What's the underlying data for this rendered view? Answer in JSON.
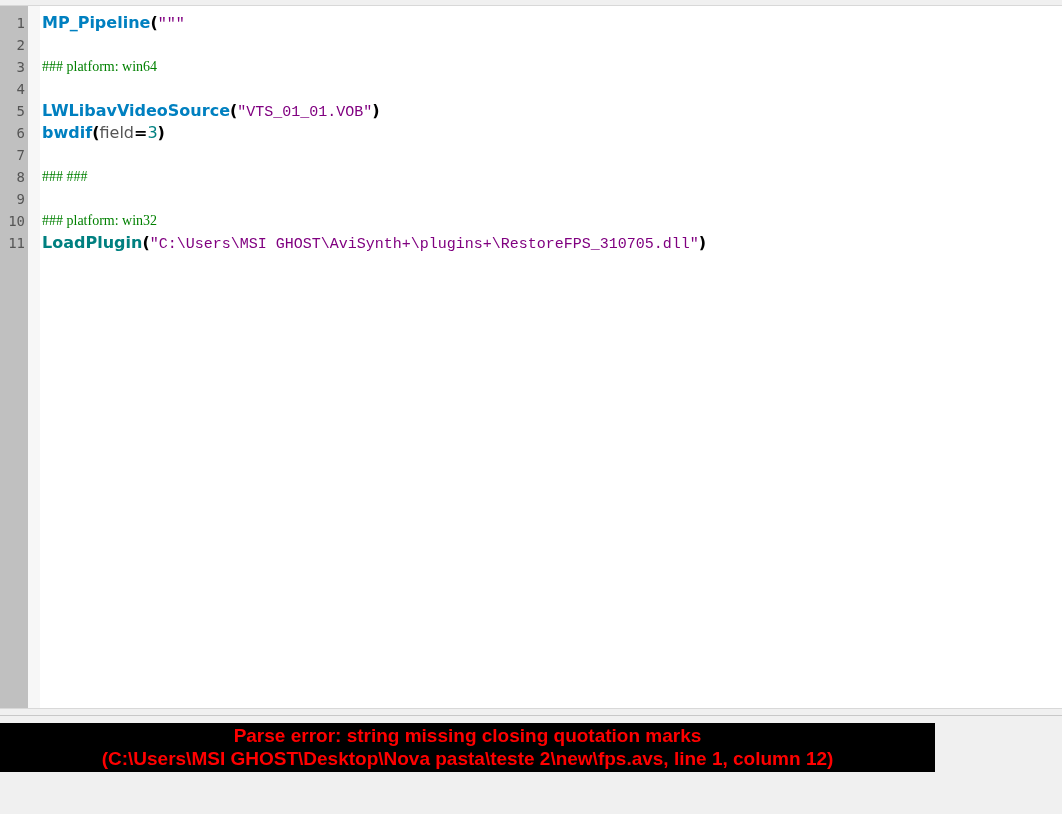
{
  "editor": {
    "lines": [
      {
        "number": "1",
        "tokens": [
          {
            "kind": "function",
            "text": "MP_Pipeline"
          },
          {
            "kind": "paren",
            "text": "("
          },
          {
            "kind": "string",
            "text": "\"\"\""
          }
        ]
      },
      {
        "number": "2"
      },
      {
        "number": "3",
        "tokens": [
          {
            "kind": "comment",
            "text": "### platform: win64"
          }
        ]
      },
      {
        "number": "4"
      },
      {
        "number": "5",
        "tokens": [
          {
            "kind": "function",
            "text": "LWLibavVideoSource"
          },
          {
            "kind": "paren",
            "text": "("
          },
          {
            "kind": "string",
            "text": "\"VTS_01_01.VOB\""
          },
          {
            "kind": "paren",
            "text": ")"
          }
        ]
      },
      {
        "number": "6",
        "tokens": [
          {
            "kind": "function",
            "text": "bwdif"
          },
          {
            "kind": "paren",
            "text": "("
          },
          {
            "kind": "argument",
            "text": "field"
          },
          {
            "kind": "paren",
            "text": "="
          },
          {
            "kind": "number",
            "text": "3"
          },
          {
            "kind": "paren",
            "text": ")"
          }
        ]
      },
      {
        "number": "7"
      },
      {
        "number": "8",
        "tokens": [
          {
            "kind": "comment",
            "text": "### ###"
          }
        ]
      },
      {
        "number": "9"
      },
      {
        "number": "10",
        "tokens": [
          {
            "kind": "comment",
            "text": "### platform: win32"
          }
        ]
      },
      {
        "number": "11",
        "tokens": [
          {
            "kind": "plugin",
            "text": "LoadPlugin"
          },
          {
            "kind": "paren",
            "text": "("
          },
          {
            "kind": "string",
            "text": "\"C:\\Users\\MSI GHOST\\AviSynth+\\plugins+\\RestoreFPS_310705.dll\""
          },
          {
            "kind": "paren",
            "text": ")"
          }
        ]
      }
    ]
  },
  "error": {
    "lines": [
      "Parse error: string missing closing quotation marks",
      "(C:\\Users\\MSI GHOST\\Desktop\\Nova pasta\\teste 2\\new\\fps.avs, line 1, column 12)"
    ]
  }
}
